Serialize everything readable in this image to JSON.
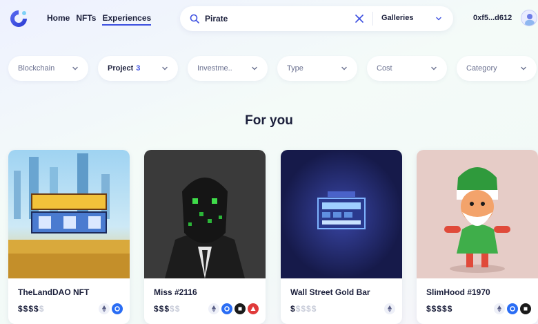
{
  "nav": {
    "items": [
      {
        "label": "Home",
        "active": false
      },
      {
        "label": "NFTs",
        "active": false
      },
      {
        "label": "Experiences",
        "active": true
      }
    ]
  },
  "search": {
    "value": "Pirate",
    "scope": "Galleries"
  },
  "wallet": {
    "address": "0xf5...d612"
  },
  "filters": [
    {
      "label": "Blockchain",
      "count": ""
    },
    {
      "label": "Project",
      "count": "3"
    },
    {
      "label": "Investme..",
      "count": ""
    },
    {
      "label": "Type",
      "count": ""
    },
    {
      "label": "Cost",
      "count": ""
    },
    {
      "label": "Category",
      "count": ""
    }
  ],
  "section": {
    "heading": "For you"
  },
  "cards": [
    {
      "title": "TheLandDAO NFT",
      "price_on": "$$$$",
      "price_off": "$",
      "chains": [
        "ethereum",
        "blue"
      ],
      "image": "landdao-pixel-art"
    },
    {
      "title": "Miss #2116",
      "price_on": "$$$",
      "price_off": "$$",
      "chains": [
        "ethereum",
        "blue",
        "black",
        "red"
      ],
      "image": "hooded-figure"
    },
    {
      "title": "Wall Street Gold Bar",
      "price_on": "$",
      "price_off": "$$$$",
      "chains": [
        "ethereum"
      ],
      "image": "pixel-device"
    },
    {
      "title": "SlimHood #1970",
      "price_on": "$$$$$",
      "price_off": "",
      "chains": [
        "ethereum",
        "blue",
        "black"
      ],
      "image": "cartoon-hood-character"
    }
  ],
  "colors": {
    "accent": "#3c4fe0",
    "ethereum_chip_bg": "#eef0f8",
    "blue_chip": "#2a6df4",
    "black_chip": "#1a1a1a",
    "red_chip": "#e03a3a"
  }
}
